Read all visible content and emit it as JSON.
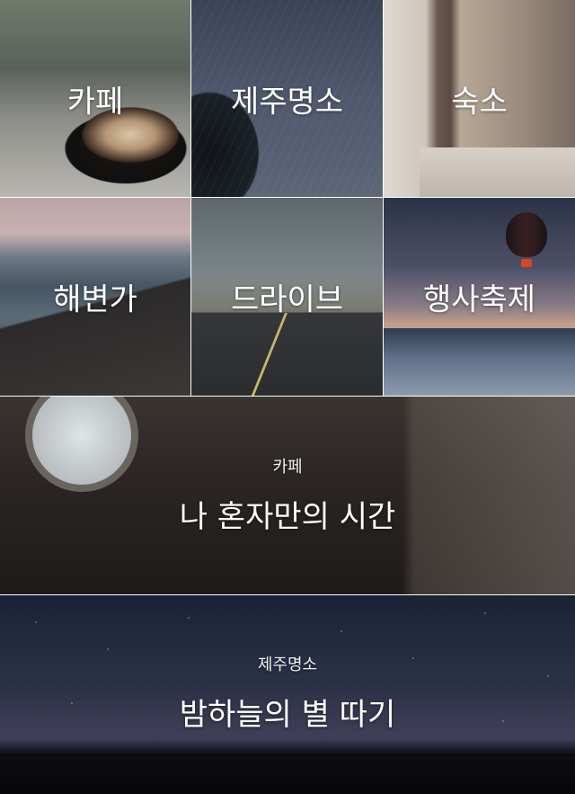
{
  "grid_tiles": [
    {
      "label": "카페"
    },
    {
      "label": "제주명소"
    },
    {
      "label": "숙소"
    },
    {
      "label": "해변가"
    },
    {
      "label": "드라이브"
    },
    {
      "label": "행사축제"
    }
  ],
  "banners": [
    {
      "category": "카페",
      "title": "나 혼자만의 시간"
    },
    {
      "category": "제주명소",
      "title": "밤하늘의 별 따기"
    }
  ]
}
